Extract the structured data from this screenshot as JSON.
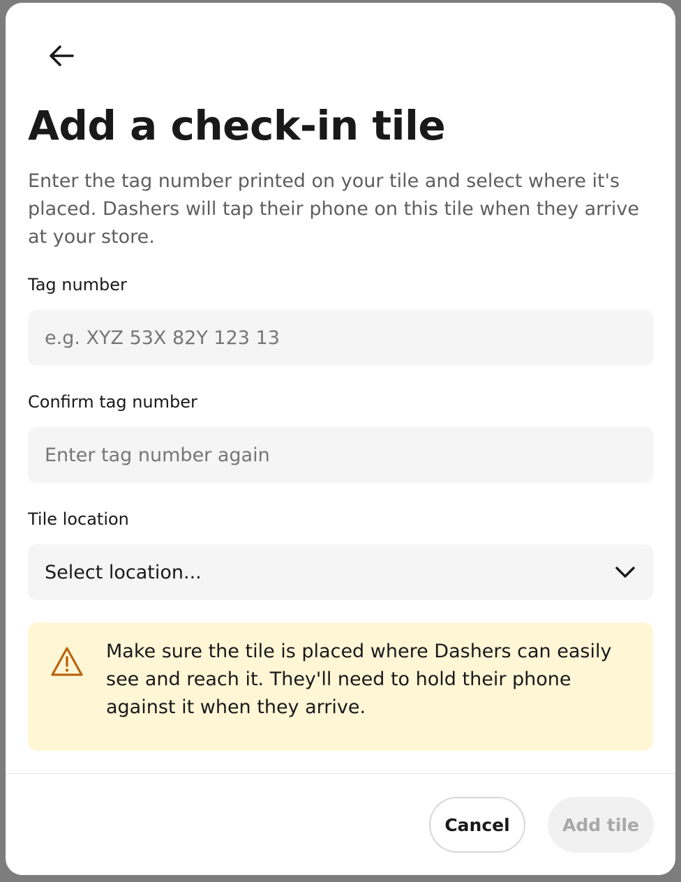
{
  "modal": {
    "title": "Add a check-in tile",
    "description": "Enter the tag number printed on your tile and select where it's placed. Dashers will tap their phone on this tile when they arrive at your store.",
    "tag_number": {
      "label": "Tag number",
      "placeholder": "e.g. XYZ 53X 82Y 123 13",
      "value": ""
    },
    "confirm_tag_number": {
      "label": "Confirm tag number",
      "placeholder": "Enter tag number again",
      "value": ""
    },
    "tile_location": {
      "label": "Tile location",
      "selected": "Select location..."
    },
    "alert": {
      "icon": "warning-triangle-icon",
      "text": "Make sure the tile is placed where Dashers can easily see and reach it. They'll need to hold their phone against it when they arrive.",
      "color": "#fff6d6",
      "icon_color": "#b8650f"
    },
    "buttons": {
      "cancel": "Cancel",
      "add": "Add tile"
    }
  }
}
